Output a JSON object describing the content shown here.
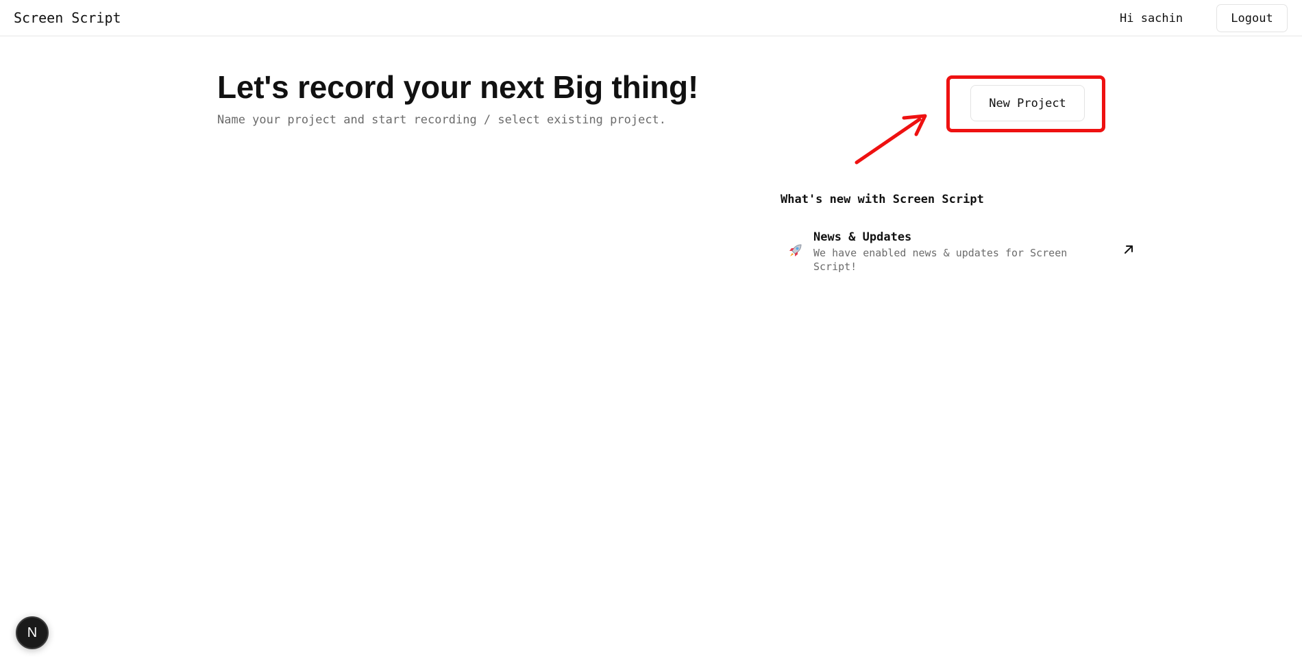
{
  "header": {
    "brand": "Screen Script",
    "greeting": "Hi sachin",
    "logout_label": "Logout"
  },
  "hero": {
    "title": "Let's record your next Big thing!",
    "subtitle": "Name your project and start recording / select existing project."
  },
  "actions": {
    "new_project_label": "New Project"
  },
  "whats_new": {
    "heading": "What's new with Screen Script",
    "items": [
      {
        "icon": "rocket-icon",
        "title": "News & Updates",
        "description": "We have enabled news & updates for Screen Script!",
        "link_icon": "arrow-up-right-icon"
      }
    ]
  },
  "dev_badge": {
    "label": "N"
  },
  "colors": {
    "annotation": "#ee1111",
    "text_primary": "#111111",
    "text_muted": "#6b6b6b",
    "border": "#e3e3e3"
  }
}
